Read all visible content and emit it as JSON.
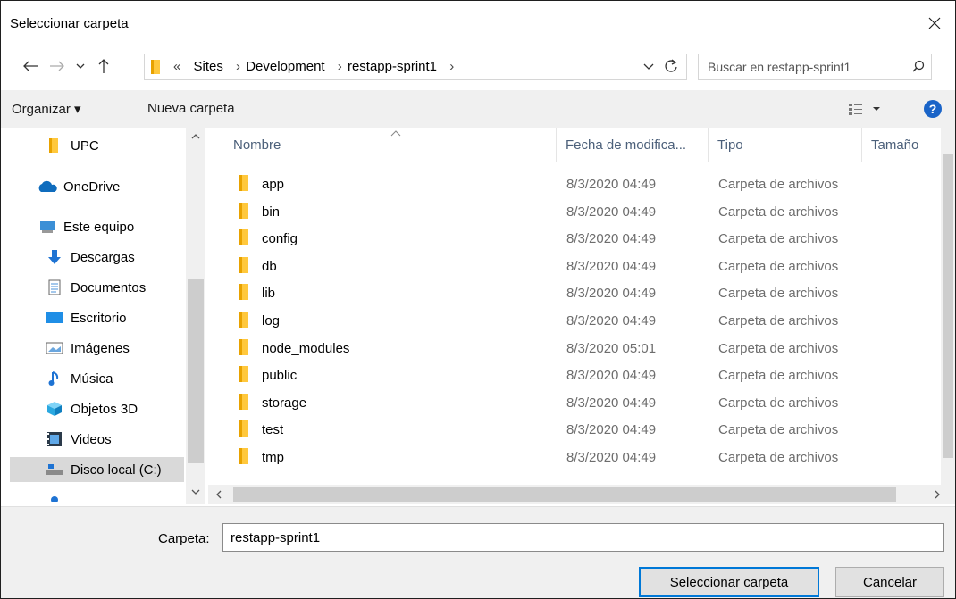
{
  "window": {
    "title": "Seleccionar carpeta"
  },
  "address": {
    "overflow": "«",
    "crumbs": [
      "Sites",
      "Development",
      "restapp-sprint1"
    ]
  },
  "search": {
    "placeholder": "Buscar en restapp-sprint1"
  },
  "toolbar": {
    "organize_label": "Organizar ▾",
    "new_folder_label": "Nueva carpeta",
    "help_label": "?"
  },
  "sidebar": {
    "items": [
      {
        "label": "UPC",
        "icon": "folder-icon"
      },
      {
        "label": "OneDrive",
        "icon": "cloud-icon"
      },
      {
        "label": "Este equipo",
        "icon": "computer-icon"
      },
      {
        "label": "Descargas",
        "icon": "download-icon"
      },
      {
        "label": "Documentos",
        "icon": "document-icon"
      },
      {
        "label": "Escritorio",
        "icon": "desktop-icon"
      },
      {
        "label": "Imágenes",
        "icon": "image-icon"
      },
      {
        "label": "Música",
        "icon": "music-icon"
      },
      {
        "label": "Objetos 3D",
        "icon": "cube-icon"
      },
      {
        "label": "Videos",
        "icon": "video-icon"
      },
      {
        "label": "Disco local (C:)",
        "icon": "drive-icon"
      }
    ]
  },
  "columns": {
    "name": "Nombre",
    "date": "Fecha de modifica...",
    "type": "Tipo",
    "size": "Tamaño"
  },
  "files": [
    {
      "name": "app",
      "date": "8/3/2020 04:49",
      "type": "Carpeta de archivos"
    },
    {
      "name": "bin",
      "date": "8/3/2020 04:49",
      "type": "Carpeta de archivos"
    },
    {
      "name": "config",
      "date": "8/3/2020 04:49",
      "type": "Carpeta de archivos"
    },
    {
      "name": "db",
      "date": "8/3/2020 04:49",
      "type": "Carpeta de archivos"
    },
    {
      "name": "lib",
      "date": "8/3/2020 04:49",
      "type": "Carpeta de archivos"
    },
    {
      "name": "log",
      "date": "8/3/2020 04:49",
      "type": "Carpeta de archivos"
    },
    {
      "name": "node_modules",
      "date": "8/3/2020 05:01",
      "type": "Carpeta de archivos"
    },
    {
      "name": "public",
      "date": "8/3/2020 04:49",
      "type": "Carpeta de archivos"
    },
    {
      "name": "storage",
      "date": "8/3/2020 04:49",
      "type": "Carpeta de archivos"
    },
    {
      "name": "test",
      "date": "8/3/2020 04:49",
      "type": "Carpeta de archivos"
    },
    {
      "name": "tmp",
      "date": "8/3/2020 04:49",
      "type": "Carpeta de archivos"
    }
  ],
  "footer": {
    "folder_label": "Carpeta:",
    "folder_value": "restapp-sprint1",
    "select_label": "Seleccionar carpeta",
    "cancel_label": "Cancelar"
  },
  "colors": {
    "accent": "#0078d7",
    "folder": "#ffc83d",
    "header_text": "#4c607a"
  }
}
